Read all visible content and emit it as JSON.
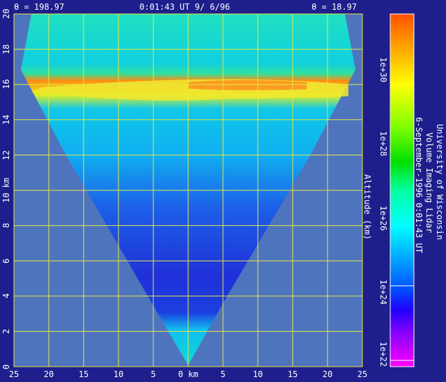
{
  "header": {
    "theta_left": "θ = 198.97",
    "time_date": "0:01:43 UT   9/ 6/96",
    "theta_right": "θ = 18.97"
  },
  "axes": {
    "y_ticks": [
      "20",
      "18",
      "16",
      "14",
      "12",
      "10 km",
      "8",
      "6",
      "4",
      "2",
      "0"
    ],
    "x_ticks": [
      "25",
      "20",
      "15",
      "10",
      "5",
      "0 km",
      "5",
      "10",
      "15",
      "20",
      "25"
    ],
    "y_label": "Altitude (km)"
  },
  "colorbar": {
    "ticks": [
      "1e+30",
      "1e+28",
      "1e+26",
      "1e+24",
      "1e+22"
    ],
    "range_exponent": [
      22,
      31.5
    ]
  },
  "caption": {
    "line1": "University of Wisconsin",
    "line2": "Volume Imaging Lidar",
    "line3": "6-September-1996  0:01:43 UT"
  },
  "colors": {
    "background": "#1e1e8c",
    "plot_area": "#4e74be",
    "grid": "#e8e840",
    "scan_base": "#00c8e6"
  }
}
